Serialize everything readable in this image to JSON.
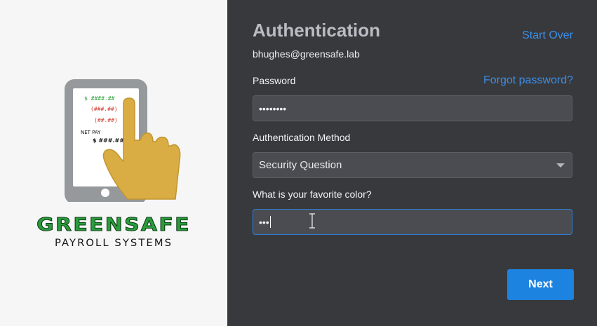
{
  "brand": {
    "name": "GREENSAFE",
    "subtitle": "PAYROLL SYSTEMS",
    "logo": {
      "icon": "phone-with-hand-icon",
      "screen_lines": [
        "$ ####.##",
        "(###.##)",
        "(##.##)",
        "NET PAY",
        "$ ###.##"
      ],
      "colors": {
        "green": "#2f9f3b",
        "red": "#d33a2d",
        "hand": "#d9ad44",
        "phone": "#95999c"
      }
    }
  },
  "auth": {
    "title": "Authentication",
    "start_over": "Start Over",
    "email": "bhughes@greensafe.lab",
    "password_label": "Password",
    "forgot_password": "Forgot password?",
    "password_value": "••••••••",
    "method_label": "Authentication Method",
    "method_selected": "Security Question",
    "question_label": "What is your favorite color?",
    "answer_value": "•••",
    "next_label": "Next"
  },
  "colors": {
    "panel_dark": "#38393d",
    "input_bg": "#4a4c51",
    "link": "#3a8ee6",
    "accent_button": "#1d83e0",
    "focus_border": "#2f7fd6"
  }
}
